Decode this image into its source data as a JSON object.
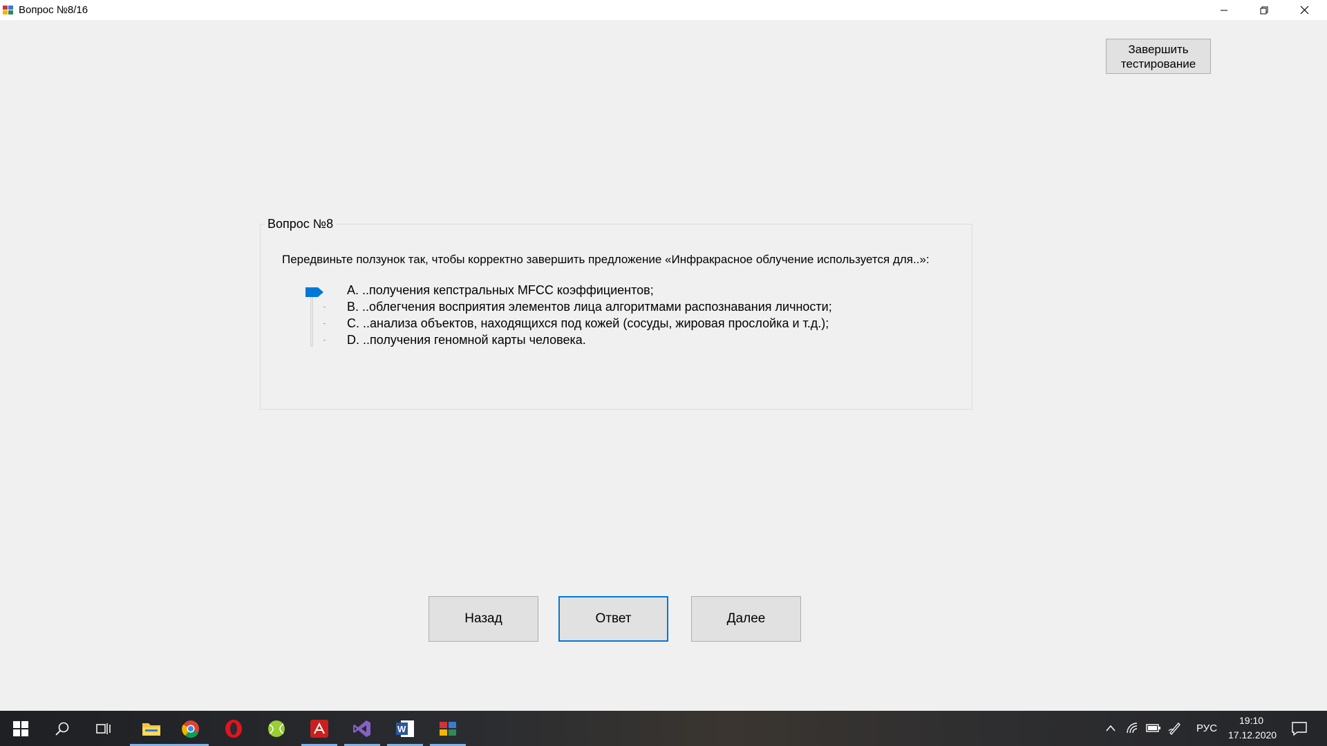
{
  "window": {
    "title": "Вопрос №8/16"
  },
  "finish_button": {
    "label": "Завершить\nтестирование"
  },
  "question": {
    "group_title": "Вопрос №8",
    "prompt": "Передвиньте ползунок так, чтобы корректно завершить предложение «Инфракрасное облучение используется для..»:",
    "options": [
      "A. ..получения кепстральных MFCC коэффициентов;",
      "B. ..облегчения восприятия элементов лица алгоритмами распознавания личности;",
      "C. ..анализа объектов, находящихся под кожей (сосуды, жировая прослойка и т.д.);",
      "D. ..получения геномной карты человека."
    ],
    "selected_index": 0
  },
  "nav": {
    "back_label": "Назад",
    "answer_label": "Ответ",
    "next_label": "Далее"
  },
  "taskbar": {
    "language": "РУС",
    "time": "19:10",
    "date": "17.12.2020",
    "apps": [
      "windows-start",
      "search",
      "task-view",
      "file-explorer",
      "chrome",
      "opera",
      "tennis-app",
      "acrobat-reader",
      "visual-studio",
      "word",
      "test-app"
    ]
  },
  "colors": {
    "accent": "#0078d7",
    "window_bg": "#f0f0f0",
    "button_bg": "#e1e1e1"
  }
}
